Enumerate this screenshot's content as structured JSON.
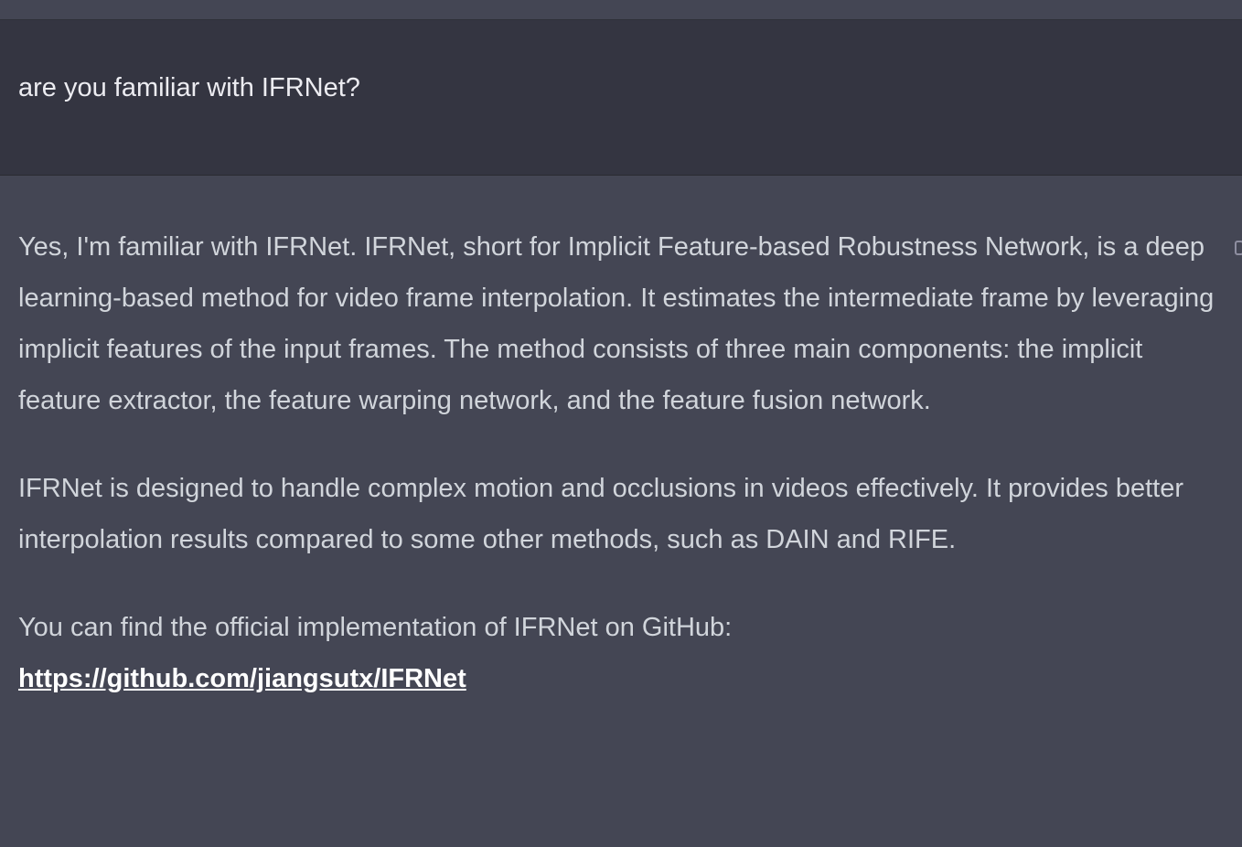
{
  "conversation": {
    "user_message": "are you familiar with IFRNet?",
    "assistant_paragraphs": [
      "Yes, I'm familiar with IFRNet. IFRNet, short for Implicit Feature-based Robustness Network, is a deep learning-based method for video frame interpolation. It estimates the intermediate frame by leveraging implicit features of the input frames. The method consists of three main components: the implicit feature extractor, the feature warping network, and the feature fusion network.",
      "IFRNet is designed to handle complex motion and occlusions in videos effectively. It provides better interpolation results compared to some other methods, such as DAIN and RIFE.",
      "You can find the official implementation of IFRNet on GitHub:"
    ],
    "link_text": "https://github.com/jiangsutx/IFRNet"
  },
  "icons": {
    "copy": "copy-icon"
  },
  "colors": {
    "user_bg": "#343541",
    "assistant_bg": "#444654",
    "text": "#d1d5db",
    "link": "#ffffff"
  }
}
